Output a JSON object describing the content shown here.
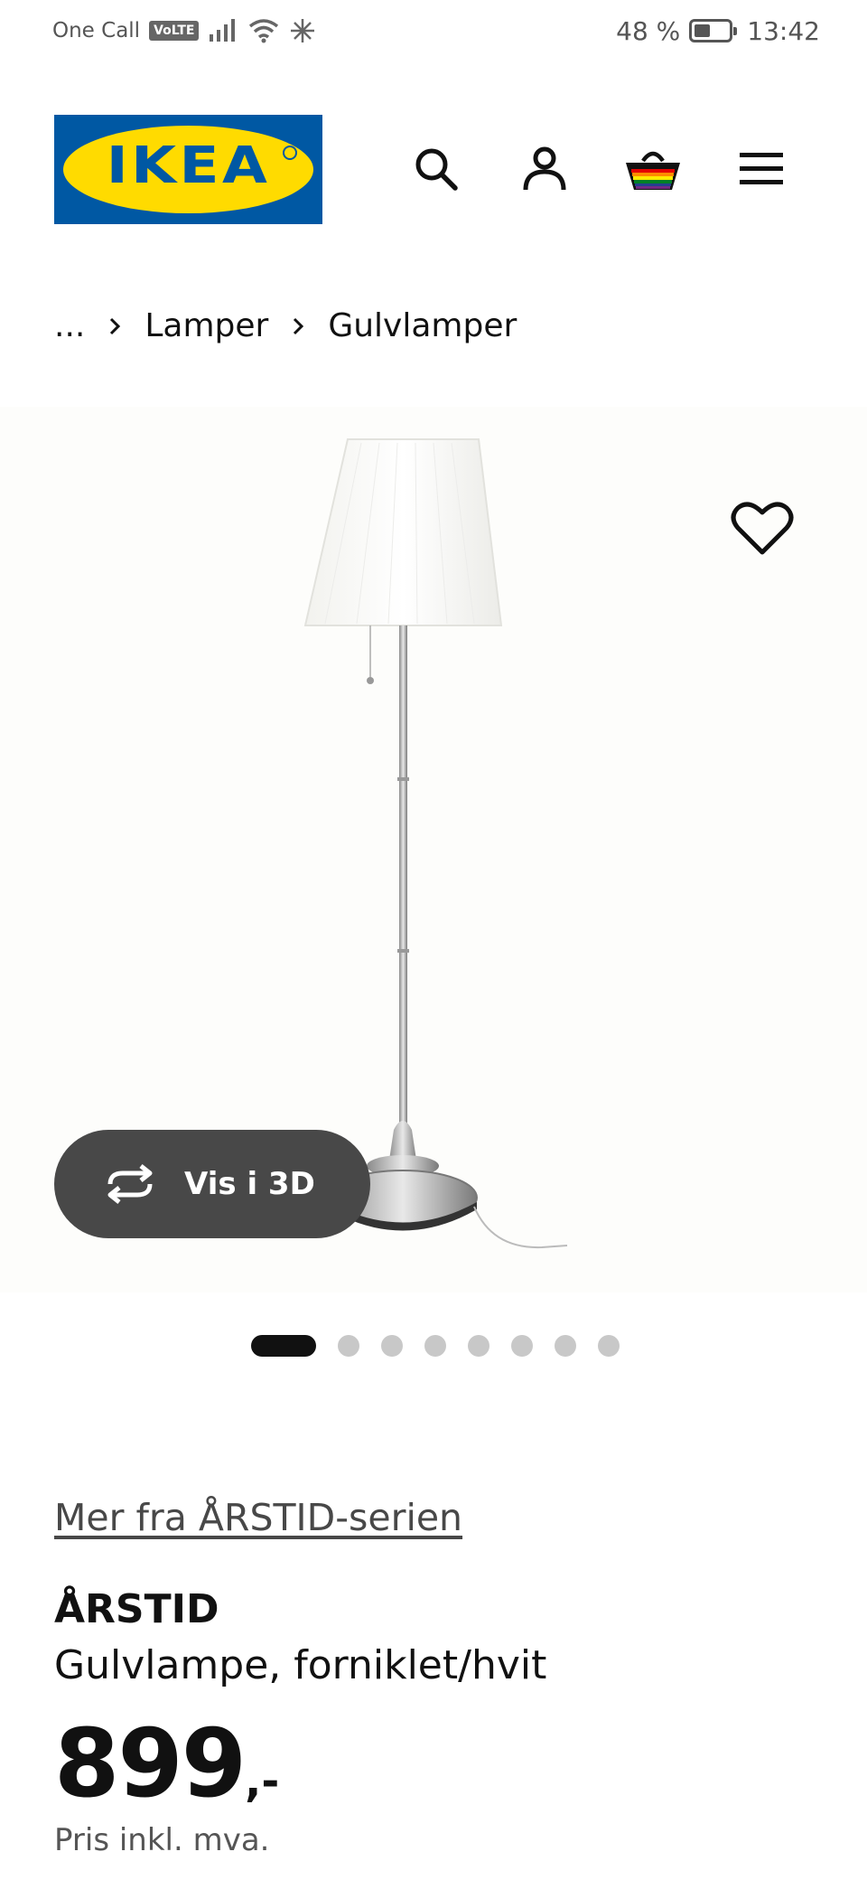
{
  "status_bar": {
    "carrier": "One Call",
    "volte_badge": "VoLTE",
    "battery_percent": "48 %",
    "battery_level": 0.48,
    "time": "13:42"
  },
  "header": {
    "logo_text": "IKEA",
    "logo_colors": {
      "background": "#0058A3",
      "oval": "#FFDB00"
    },
    "icons": [
      "search-icon",
      "account-icon",
      "cart-icon",
      "menu-icon"
    ]
  },
  "breadcrumb": {
    "ellipsis": "...",
    "items": [
      "Lamper",
      "Gulvlamper"
    ]
  },
  "gallery": {
    "view_3d_label": "Vis i 3D",
    "image_count": 8,
    "active_index": 0
  },
  "product": {
    "series_link": "Mer fra ÅRSTID-serien",
    "name": "ÅRSTID",
    "description": "Gulvlampe, forniklet/hvit",
    "price_integer": "899",
    "price_decimal": ",-",
    "price_note": "Pris inkl. mva."
  }
}
